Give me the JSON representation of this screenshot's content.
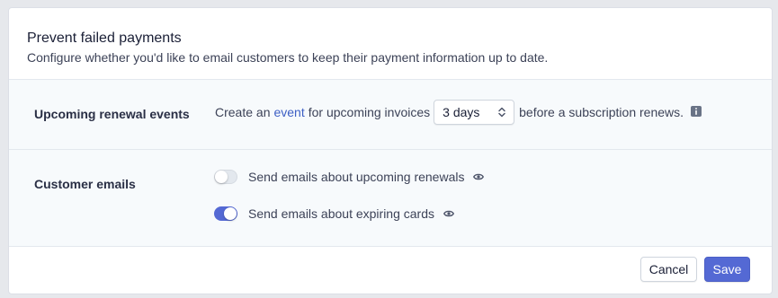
{
  "header": {
    "title": "Prevent failed payments",
    "subtitle": "Configure whether you'd like to email customers to keep their payment information up to date."
  },
  "renewal": {
    "label": "Upcoming renewal events",
    "text_before": "Create an",
    "link_text": "event",
    "text_middle": "for upcoming invoices",
    "select_value": "3 days",
    "text_after": "before a subscription renews.",
    "info_icon": "info-icon"
  },
  "emails": {
    "label": "Customer emails",
    "options": [
      {
        "label": "Send emails about upcoming renewals",
        "enabled": false,
        "icon": "eye-icon"
      },
      {
        "label": "Send emails about expiring cards",
        "enabled": true,
        "icon": "eye-icon"
      }
    ]
  },
  "footer": {
    "cancel_label": "Cancel",
    "save_label": "Save"
  },
  "colors": {
    "accent": "#5469d4",
    "link": "#3d5fc4",
    "section_bg": "#f7fafc"
  }
}
